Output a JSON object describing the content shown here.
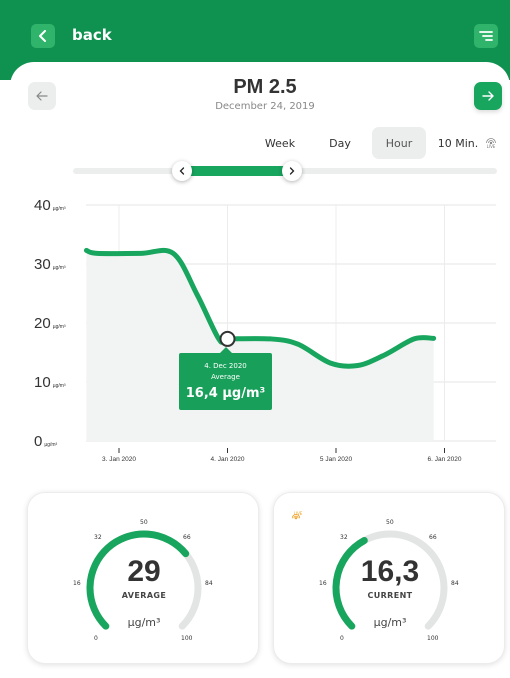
{
  "header": {
    "back_label": "back"
  },
  "page": {
    "title": "PM 2.5",
    "date": "December 24, 2019"
  },
  "range_tabs": [
    {
      "label": "Week",
      "active": false
    },
    {
      "label": "Day",
      "active": false
    },
    {
      "label": "Hour",
      "active": true
    },
    {
      "label": "10 Min.",
      "active": false
    }
  ],
  "live_label": "LIVE",
  "colors": {
    "brand": "#0f9150",
    "accent": "#18a55e",
    "gauge_track": "#e2e5e3"
  },
  "chart_data": {
    "type": "area",
    "y_unit": "µg/m³",
    "ylim": [
      0,
      40
    ],
    "yticks": [
      {
        "value": 40,
        "label": "40"
      },
      {
        "value": 30,
        "label": "30"
      },
      {
        "value": 20,
        "label": "20"
      },
      {
        "value": 10,
        "label": "10"
      },
      {
        "value": 0,
        "label": "0"
      }
    ],
    "x_ticks": [
      "3. Jan 2020",
      "4. Jan 2020",
      "5 Jan 2020",
      "6. Jan 2020"
    ],
    "xlim": [
      -0.3,
      3.35
    ],
    "points": [
      {
        "x": -0.3,
        "y": 32.3
      },
      {
        "x": -0.2,
        "y": 31.8
      },
      {
        "x": 0.2,
        "y": 31.8
      },
      {
        "x": 0.5,
        "y": 31.8
      },
      {
        "x": 0.72,
        "y": 24.8
      },
      {
        "x": 0.92,
        "y": 17.3
      },
      {
        "x": 1.0,
        "y": 17.3
      },
      {
        "x": 1.4,
        "y": 17.3
      },
      {
        "x": 1.65,
        "y": 16.4
      },
      {
        "x": 1.95,
        "y": 13.2
      },
      {
        "x": 2.2,
        "y": 12.8
      },
      {
        "x": 2.45,
        "y": 14.6
      },
      {
        "x": 2.72,
        "y": 17.3
      },
      {
        "x": 2.9,
        "y": 17.4
      }
    ],
    "highlight": {
      "x": 1.0,
      "y": 17.3
    },
    "tooltip": {
      "date": "4. Dec 2020",
      "label": "Average",
      "value": "16,4 µg/m³"
    },
    "grid": true
  },
  "gauges": [
    {
      "value": "29",
      "label": "AVERAGE",
      "unit": "µg/m³",
      "fraction": 0.29,
      "live": false,
      "ticks": [
        "0",
        "16",
        "32",
        "50",
        "66",
        "84",
        "100"
      ]
    },
    {
      "value": "16,3",
      "label": "CURRENT",
      "unit": "µg/m³",
      "fraction": 0.163,
      "live": true,
      "ticks": [
        "0",
        "16",
        "32",
        "50",
        "66",
        "84",
        "100"
      ]
    }
  ]
}
